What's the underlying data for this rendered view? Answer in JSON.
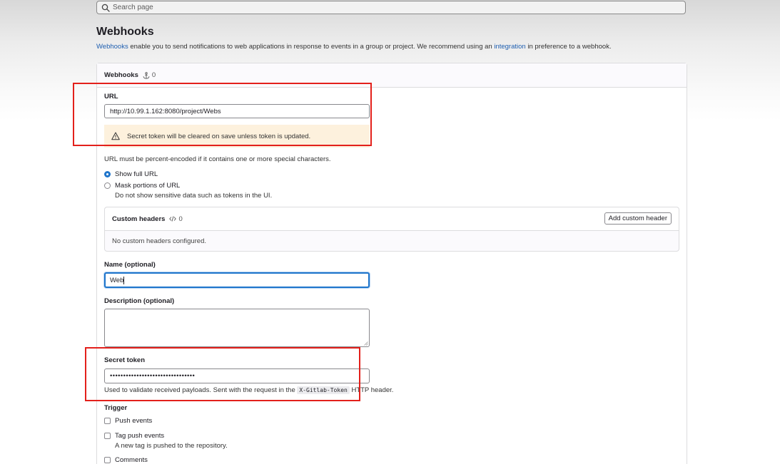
{
  "search": {
    "placeholder": "Search page"
  },
  "page": {
    "title": "Webhooks",
    "description": {
      "link1": "Webhooks",
      "mid": " enable you to send notifications to web applications in response to events in a group or project. We recommend using an ",
      "link2": "integration",
      "end": " in preference to a webhook."
    }
  },
  "card": {
    "title": "Webhooks",
    "count": "0"
  },
  "url": {
    "label": "URL",
    "value": "http://10.99.1.162:8080/project/Webs",
    "warning": "Secret token will be cleared on save unless token is updated.",
    "help": "URL must be percent-encoded if it contains one or more special characters.",
    "options": [
      {
        "label": "Show full URL",
        "checked": true
      },
      {
        "label": "Mask portions of URL",
        "sub": "Do not show sensitive data such as tokens in the UI.",
        "checked": false
      }
    ]
  },
  "custom_headers": {
    "title": "Custom headers",
    "count": "0",
    "add_label": "Add custom header",
    "empty": "No custom headers configured."
  },
  "name": {
    "label": "Name (optional)",
    "value": "Web"
  },
  "description_field": {
    "label": "Description (optional)",
    "value": ""
  },
  "secret": {
    "label": "Secret token",
    "value": "••••••••••••••••••••••••••••••••",
    "help_before": "Used to validate received payloads. Sent with the request in the ",
    "help_code": "X-Gitlab-Token",
    "help_after": " HTTP header."
  },
  "trigger": {
    "label": "Trigger",
    "items": [
      {
        "label": "Push events",
        "sub": ""
      },
      {
        "label": "Tag push events",
        "sub": "A new tag is pushed to the repository."
      },
      {
        "label": "Comments",
        "sub": ""
      }
    ]
  },
  "colors": {
    "accent": "#1f75cb",
    "highlight": "#e3201b",
    "warning_bg": "#fdf1dd",
    "link": "#1f5fb0"
  }
}
